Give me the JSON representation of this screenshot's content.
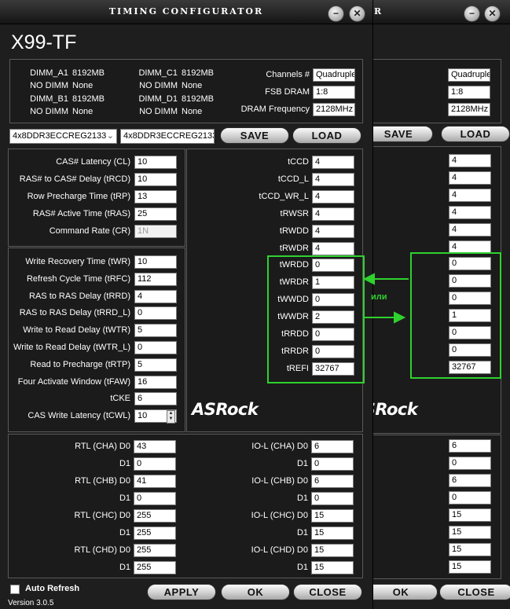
{
  "window": {
    "title": "Timing Configurator",
    "board": "X99-TF",
    "minimize_glyph": "−",
    "close_glyph": "✕",
    "version": "Version 3.0.5"
  },
  "dimm": {
    "slots": [
      {
        "name": "DIMM_A1",
        "value": "8192MB"
      },
      {
        "name": "NO DIMM",
        "value": "None"
      },
      {
        "name": "DIMM_B1",
        "value": "8192MB"
      },
      {
        "name": "NO DIMM",
        "value": "None"
      },
      {
        "name": "DIMM_C1",
        "value": "8192MB"
      },
      {
        "name": "NO DIMM",
        "value": "None"
      },
      {
        "name": "DIMM_D1",
        "value": "8192MB"
      },
      {
        "name": "NO DIMM",
        "value": "None"
      }
    ],
    "channels_label": "Channels #",
    "channels_value": "Quadruple",
    "fsb_label": "FSB DRAM",
    "fsb_value": "1:8",
    "freq_label": "DRAM Frequency",
    "freq_value": "2128MHz"
  },
  "profile": {
    "select_value": "4x8DDR3ECCREG2133",
    "text_value": "4x8DDR3ECCREG2133"
  },
  "buttons": {
    "save": "SAVE",
    "load": "LOAD",
    "apply": "APPLY",
    "ok": "OK",
    "close": "CLOSE"
  },
  "primary": [
    {
      "label": "CAS# Latency (CL)",
      "value": "10"
    },
    {
      "label": "RAS# to CAS# Delay (tRCD)",
      "value": "10"
    },
    {
      "label": "Row Precharge Time (tRP)",
      "value": "13"
    },
    {
      "label": "RAS# Active Time (tRAS)",
      "value": "25"
    },
    {
      "label": "Command Rate (CR)",
      "value": "1N"
    }
  ],
  "secondary": [
    {
      "label": "Write Recovery Time (tWR)",
      "value": "10"
    },
    {
      "label": "Refresh Cycle Time (tRFC)",
      "value": "112"
    },
    {
      "label": "RAS to RAS Delay (tRRD)",
      "value": "4"
    },
    {
      "label": "RAS to RAS Delay (tRRD_L)",
      "value": "0"
    },
    {
      "label": "Write to Read Delay (tWTR)",
      "value": "5"
    },
    {
      "label": "Write to Read Delay (tWTR_L)",
      "value": "0"
    },
    {
      "label": "Read to Precharge (tRTP)",
      "value": "5"
    },
    {
      "label": "Four Activate Window (tFAW)",
      "value": "16"
    },
    {
      "label": "tCKE",
      "value": "6"
    },
    {
      "label": "CAS Write Latency (tCWL)",
      "value": "10"
    }
  ],
  "turnaround_front": [
    {
      "label": "tCCD",
      "value": "4"
    },
    {
      "label": "tCCD_L",
      "value": "4"
    },
    {
      "label": "tCCD_WR_L",
      "value": "4"
    },
    {
      "label": "tRWSR",
      "value": "4"
    },
    {
      "label": "tRWDD",
      "value": "4"
    },
    {
      "label": "tRWDR",
      "value": "4"
    },
    {
      "label": "tWRDD",
      "value": "0"
    },
    {
      "label": "tWRDR",
      "value": "1"
    },
    {
      "label": "tWWDD",
      "value": "0"
    },
    {
      "label": "tWWDR",
      "value": "2"
    },
    {
      "label": "tRRDD",
      "value": "0"
    },
    {
      "label": "tRRDR",
      "value": "0"
    },
    {
      "label": "tREFI",
      "value": "32767"
    }
  ],
  "turnaround_back": [
    {
      "label": "tCCD",
      "value": "4"
    },
    {
      "label": "tCCD_L",
      "value": "4"
    },
    {
      "label": "tCCD_WR_L",
      "value": "4"
    },
    {
      "label": "tRWSR",
      "value": "4"
    },
    {
      "label": "tRWDD",
      "value": "4"
    },
    {
      "label": "tRWDR",
      "value": "4"
    },
    {
      "label": "tWRDD",
      "value": "0"
    },
    {
      "label": "tWRDR",
      "value": "0"
    },
    {
      "label": "tWWDD",
      "value": "0"
    },
    {
      "label": "tWWDR",
      "value": "1"
    },
    {
      "label": "tRRDD",
      "value": "0"
    },
    {
      "label": "tRRDR",
      "value": "0"
    },
    {
      "label": "tREFI",
      "value": "32767"
    }
  ],
  "logo": "ASRock",
  "annotation": {
    "text": "или",
    "color": "#2fd12f"
  },
  "rtl": [
    {
      "label": "RTL (CHA) D0",
      "value": "43"
    },
    {
      "label": "D1",
      "value": "0"
    },
    {
      "label": "RTL (CHB) D0",
      "value": "41"
    },
    {
      "label": "D1",
      "value": "0"
    },
    {
      "label": "RTL (CHC) D0",
      "value": "255"
    },
    {
      "label": "D1",
      "value": "255"
    },
    {
      "label": "RTL (CHD) D0",
      "value": "255"
    },
    {
      "label": "D1",
      "value": "255"
    }
  ],
  "iol_front": [
    {
      "label": "IO-L (CHA) D0",
      "value": "6"
    },
    {
      "label": "D1",
      "value": "0"
    },
    {
      "label": "IO-L (CHB) D0",
      "value": "6"
    },
    {
      "label": "D1",
      "value": "0"
    },
    {
      "label": "IO-L (CHC) D0",
      "value": "15"
    },
    {
      "label": "D1",
      "value": "15"
    },
    {
      "label": "IO-L (CHD) D0",
      "value": "15"
    },
    {
      "label": "D1",
      "value": "15"
    }
  ],
  "iol_back": [
    {
      "label": "IO-L (CHA) D0",
      "value": "6"
    },
    {
      "label": "D1",
      "value": "0"
    },
    {
      "label": "IO-L (CHB) D0",
      "value": "6"
    },
    {
      "label": "D1",
      "value": "0"
    },
    {
      "label": "IO-L (CHC) D0",
      "value": "15"
    },
    {
      "label": "D1",
      "value": "15"
    },
    {
      "label": "IO-L (CHD) D0",
      "value": "15"
    },
    {
      "label": "D1",
      "value": "15"
    }
  ],
  "auto_refresh": {
    "label": "Auto Refresh",
    "checked": false
  }
}
